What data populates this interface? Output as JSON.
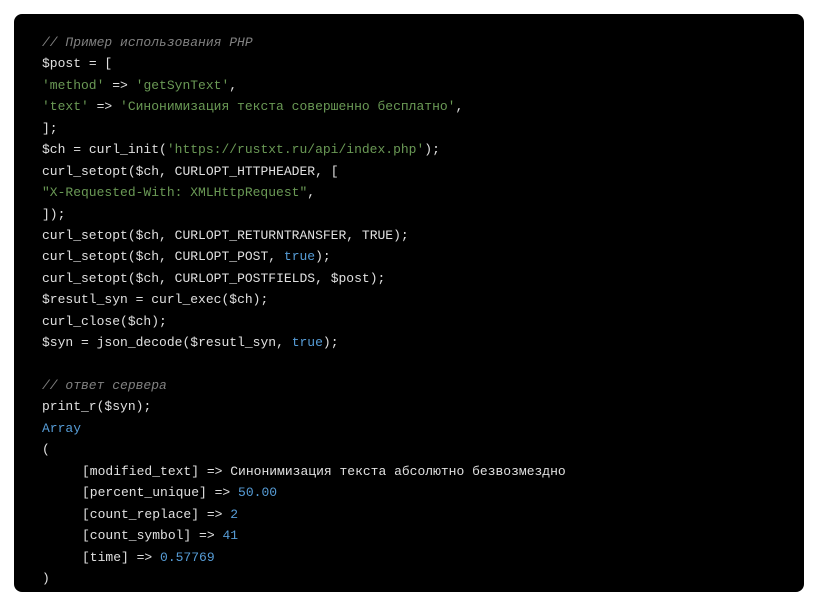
{
  "code": {
    "l1": "// Пример использования PHP",
    "l2_var": "$post",
    "l2_eq": " = [",
    "l3_key": "'method'",
    "l3_arrow": " => ",
    "l3_val": "'getSynText'",
    "l3_comma": ",",
    "l4_key": "'text'",
    "l4_arrow": " => ",
    "l4_val": "'Синонимизация текста совершенно бесплатно'",
    "l4_comma": ",",
    "l5": "];",
    "l6_var": "$ch",
    "l6_eq": " = ",
    "l6_fn": "curl_init",
    "l6_p1": "(",
    "l6_url": "'https://rustxt.ru/api/index.php'",
    "l6_p2": ");",
    "l7_fn": "curl_setopt",
    "l7_p1": "(",
    "l7_a1": "$ch",
    "l7_c1": ", ",
    "l7_a2": "CURLOPT_HTTPHEADER",
    "l7_c2": ", [",
    "l8": "\"X-Requested-With: XMLHttpRequest\"",
    "l8_c": ",",
    "l9": "]);",
    "l10_fn": "curl_setopt",
    "l10_p": "(",
    "l10_a1": "$ch",
    "l10_c1": ", ",
    "l10_a2": "CURLOPT_RETURNTRANSFER",
    "l10_c2": ", ",
    "l10_a3": "TRUE",
    "l10_e": ");",
    "l11_fn": "curl_setopt",
    "l11_p": "(",
    "l11_a1": "$ch",
    "l11_c1": ", ",
    "l11_a2": "CURLOPT_POST",
    "l11_c2": ", ",
    "l11_a3": "true",
    "l11_e": ");",
    "l12_fn": "curl_setopt",
    "l12_p": "(",
    "l12_a1": "$ch",
    "l12_c1": ", ",
    "l12_a2": "CURLOPT_POSTFIELDS",
    "l12_c2": ", ",
    "l12_a3": "$post",
    "l12_e": ");",
    "l13_var": "$resutl_syn",
    "l13_eq": " = ",
    "l13_fn": "curl_exec",
    "l13_p": "(",
    "l13_a": "$ch",
    "l13_e": ");",
    "l14_fn": "curl_close",
    "l14_p": "(",
    "l14_a": "$ch",
    "l14_e": ");",
    "l15_var": "$syn",
    "l15_eq": " = ",
    "l15_fn": "json_decode",
    "l15_p": "(",
    "l15_a1": "$resutl_syn",
    "l15_c": ", ",
    "l15_a2": "true",
    "l15_e": ");",
    "l17": "// ответ сервера",
    "l18_fn": "print_r",
    "l18_p": "(",
    "l18_a": "$syn",
    "l18_e": ");",
    "l19": "Array",
    "l20": "(",
    "l21_k": "[modified_text]",
    "l21_arr": " => ",
    "l21_v": "Синонимизация текста абсолютно безвозмездно",
    "l22_k": "[percent_unique]",
    "l22_arr": " => ",
    "l22_v": "50.00",
    "l23_k": "[count_replace]",
    "l23_arr": " => ",
    "l23_v": "2",
    "l24_k": "[count_symbol]",
    "l24_arr": " => ",
    "l24_v": "41",
    "l25_k": "[time]",
    "l25_arr": " => ",
    "l25_v": "0.57769",
    "l26": ")"
  }
}
